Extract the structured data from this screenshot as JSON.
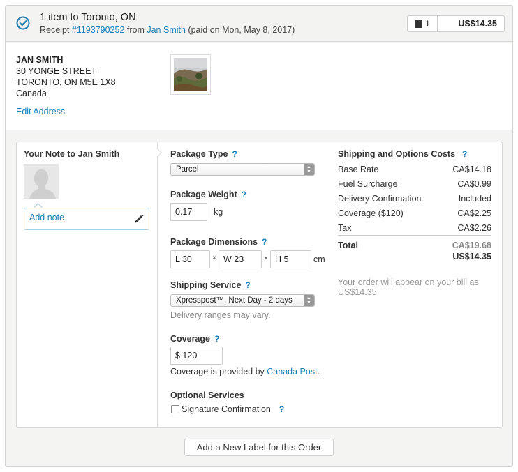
{
  "header": {
    "title": "1 item to Toronto, ON",
    "receipt_prefix": "Receipt ",
    "receipt_number": "#1193790252",
    "from_text": " from ",
    "buyer_name": "Jan Smith",
    "paid_text": " (paid on Mon, May 8, 2017)",
    "item_count": "1",
    "total": "US$14.35"
  },
  "address": {
    "name": "JAN SMITH",
    "street": "30 YONGE STREET",
    "city": "TORONTO, ON M5E 1X8",
    "country": "Canada",
    "edit_label": "Edit Address"
  },
  "note": {
    "title": "Your Note to Jan Smith",
    "add_label": "Add note"
  },
  "package": {
    "type_label": "Package Type",
    "type_value": "Parcel",
    "weight_label": "Package Weight",
    "weight_value": "0.17",
    "weight_unit": "kg",
    "dims_label": "Package Dimensions",
    "length": "L  30",
    "width": "W  23",
    "height": "H  5",
    "times": "×",
    "dims_unit": "cm",
    "service_label": "Shipping Service",
    "service_value": "Xpresspost™, Next Day - 2 days",
    "service_hint": "Delivery ranges may vary.",
    "coverage_label": "Coverage",
    "coverage_value": "$  120",
    "coverage_text": "Coverage is provided by ",
    "coverage_provider": "Canada Post",
    "coverage_period": ".",
    "optional_label": "Optional Services",
    "signature_label": "Signature Confirmation",
    "help": "?"
  },
  "costs": {
    "title": "Shipping and Options Costs",
    "rows": [
      {
        "label": "Base Rate",
        "value": "CA$14.18"
      },
      {
        "label": "Fuel Surcharge",
        "value": "CA$0.99"
      },
      {
        "label": "Delivery Confirmation",
        "value": "Included"
      },
      {
        "label": "Coverage ($120)",
        "value": "CA$2.25"
      },
      {
        "label": "Tax",
        "value": "CA$2.26"
      }
    ],
    "total_label": "Total",
    "total_ca": "CA$19.68",
    "total_us": "US$14.35",
    "bill_note": "Your order will appear on your bill as US$14.35"
  },
  "footer": {
    "add_label_button": "Add a New Label for this Order"
  },
  "colors": {
    "accent": "#1b7fb5",
    "header_bg": "#f3f3f1"
  }
}
